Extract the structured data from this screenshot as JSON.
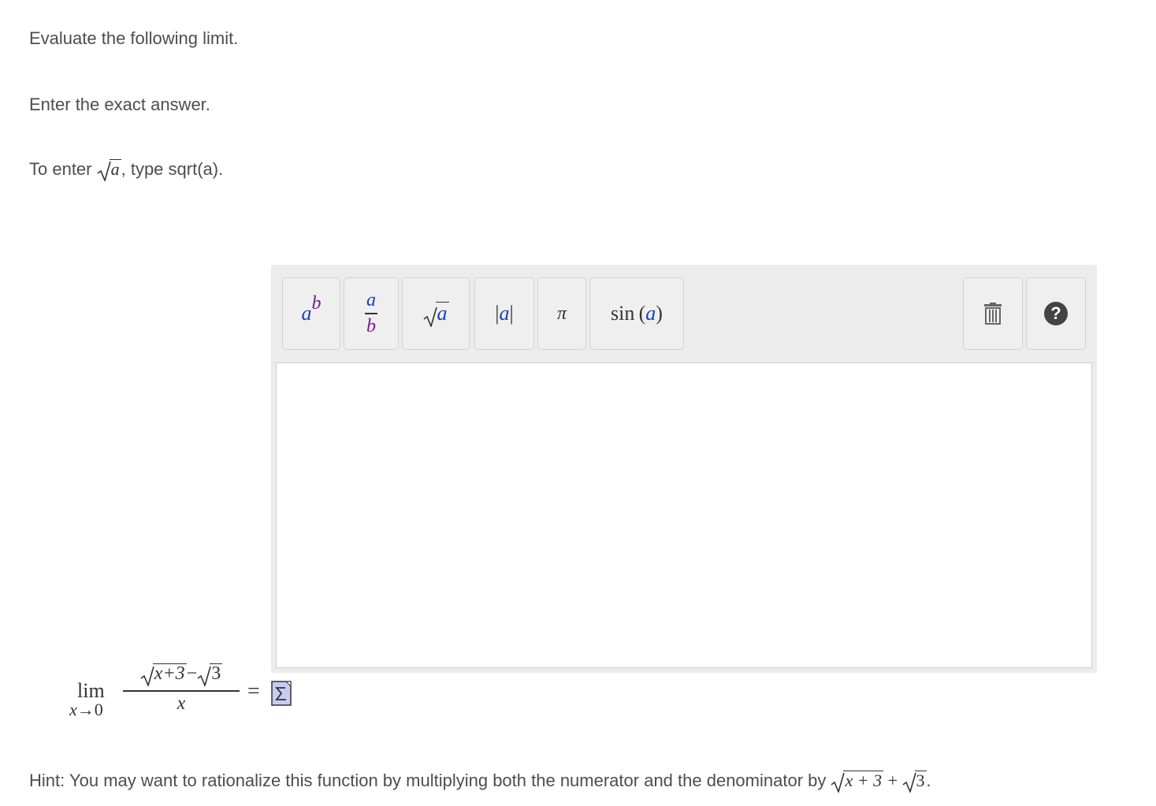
{
  "question": {
    "line1": "Evaluate the following limit.",
    "line2": "Enter the exact answer.",
    "line3_prefix": "To enter ",
    "line3_radicand": "a",
    "line3_suffix": ", type sqrt(a)."
  },
  "toolbar": {
    "power": {
      "base": "a",
      "exponent": "b"
    },
    "fraction": {
      "numerator": "a",
      "denominator": "b"
    },
    "sqrt": {
      "radicand": "a"
    },
    "abs": {
      "left": "|",
      "inner": "a",
      "right": "|"
    },
    "pi": "π",
    "sin": {
      "func": "sin",
      "open": "(",
      "arg": "a",
      "close": ")"
    },
    "trash_icon": "trash-icon",
    "help_icon": "help-icon",
    "help_symbol": "?"
  },
  "editor": {
    "value": ""
  },
  "limit": {
    "lim": "lim",
    "sub_var": "x",
    "sub_arrow": "→",
    "sub_to": "0",
    "num_left_radicand": "x+3",
    "num_minus": "−",
    "num_right_radicand": "3",
    "denominator": "x",
    "equals": "="
  },
  "hint": {
    "prefix": "Hint: You may want to rationalize this function by multiplying both the numerator and the denominator by ",
    "radicand1": "x + 3",
    "plus": " + ",
    "radicand2": "3",
    "end": "."
  },
  "colors": {
    "var_a": "#1a3fb8",
    "var_b": "#7a1a8e",
    "toolbar_bg": "#ececec",
    "text": "#4d4d4d"
  }
}
